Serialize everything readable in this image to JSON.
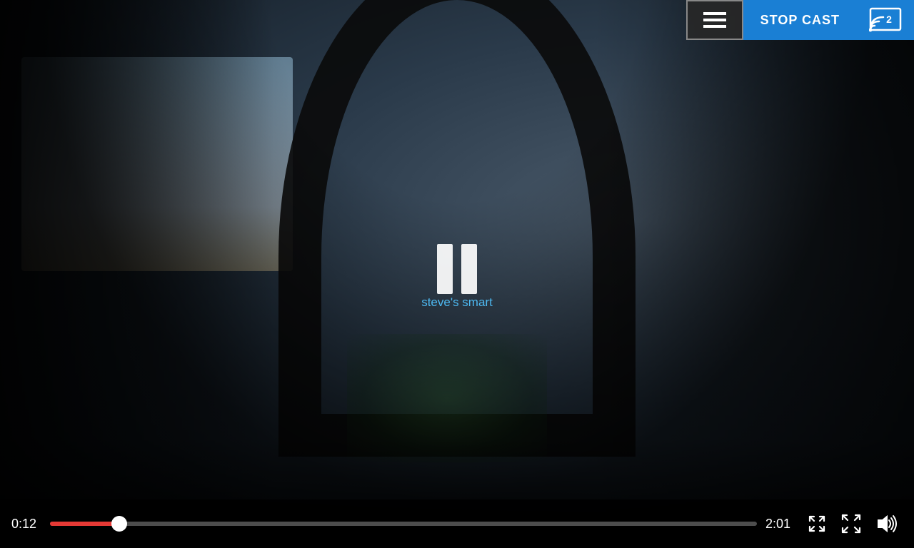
{
  "video": {
    "current_time": "0:12",
    "total_time": "2:01",
    "progress_percent": 9.8,
    "paused": true,
    "cast_device": "steve's smart"
  },
  "controls": {
    "stop_cast_label": "STOP CAST",
    "cast_number": "2",
    "menu_icon": "menu-icon",
    "pause_icon": "pause-icon",
    "fullscreen_icon": "fullscreen-icon",
    "shrink_icon": "shrink-icon",
    "volume_icon": "volume-icon"
  },
  "colors": {
    "accent": "#1a7fd4",
    "progress_fill": "#e53935",
    "cast_label": "#4db8f0",
    "stop_cast_bg": "#1a7fd4"
  }
}
